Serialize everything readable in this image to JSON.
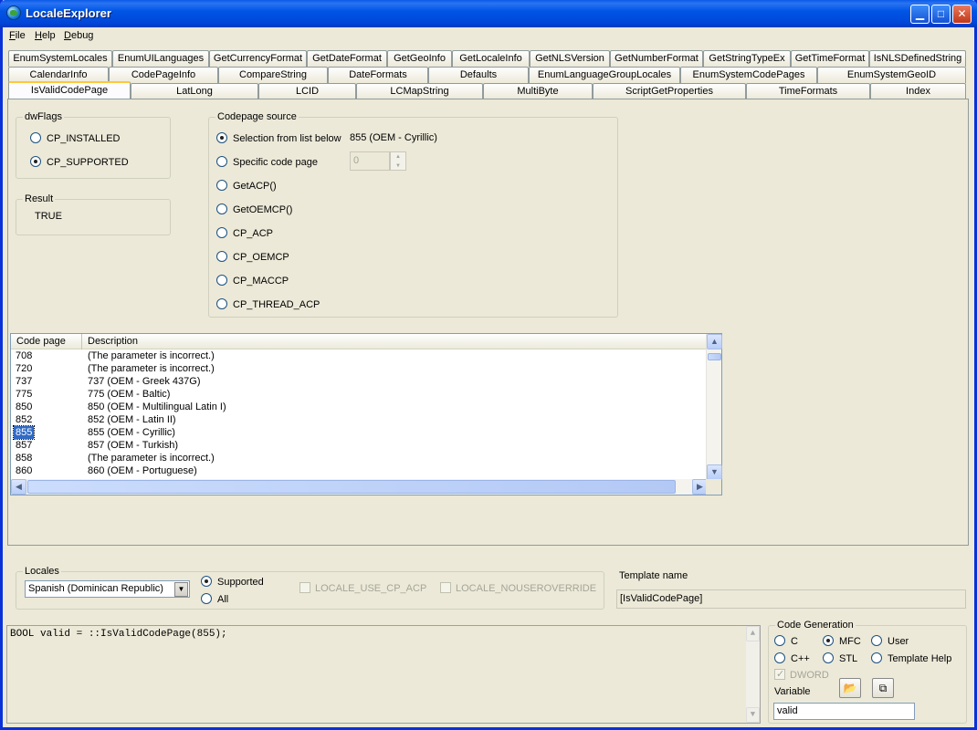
{
  "window": {
    "title": "LocaleExplorer"
  },
  "menu": [
    {
      "label": "File",
      "accel": "F",
      "rest": "ile"
    },
    {
      "label": "Help",
      "accel": "H",
      "rest": "elp"
    },
    {
      "label": "Debug",
      "accel": "D",
      "rest": "ebug"
    }
  ],
  "tabs": {
    "row1": [
      "EnumSystemLocales",
      "EnumUILanguages",
      "GetCurrencyFormat",
      "GetDateFormat",
      "GetGeoInfo",
      "GetLocaleInfo",
      "GetNLSVersion",
      "GetNumberFormat",
      "GetStringTypeEx",
      "GetTimeFormat",
      "IsNLSDefinedString"
    ],
    "row2": [
      "CalendarInfo",
      "CodePageInfo",
      "CompareString",
      "DateFormats",
      "Defaults",
      "EnumLanguageGroupLocales",
      "EnumSystemCodePages",
      "EnumSystemGeoID"
    ],
    "row3": [
      "IsValidCodePage",
      "LatLong",
      "LCID",
      "LCMapString",
      "MultiByte",
      "ScriptGetProperties",
      "TimeFormats",
      "Index"
    ],
    "active": "IsValidCodePage"
  },
  "dwflags": {
    "legend": "dwFlags",
    "options": [
      {
        "label": "CP_INSTALLED",
        "selected": false
      },
      {
        "label": "CP_SUPPORTED",
        "selected": true
      }
    ]
  },
  "result": {
    "legend": "Result",
    "value": "TRUE"
  },
  "codepage_source": {
    "legend": "Codepage source",
    "options": [
      {
        "label": "Selection from list below",
        "selected": true
      },
      {
        "label": "Specific code page",
        "selected": false
      },
      {
        "label": "GetACP()",
        "selected": false
      },
      {
        "label": "GetOEMCP()",
        "selected": false
      },
      {
        "label": "CP_ACP",
        "selected": false
      },
      {
        "label": "CP_OEMCP",
        "selected": false
      },
      {
        "label": "CP_MACCP",
        "selected": false
      },
      {
        "label": "CP_THREAD_ACP",
        "selected": false
      }
    ],
    "selection_display": "855   (OEM - Cyrillic)",
    "specific_value": "0"
  },
  "codepage_list": {
    "columns": [
      "Code page",
      "Description"
    ],
    "rows": [
      {
        "code": "708",
        "desc": "(The parameter is incorrect.)"
      },
      {
        "code": "720",
        "desc": "(The parameter is incorrect.)"
      },
      {
        "code": "737",
        "desc": "737   (OEM - Greek 437G)"
      },
      {
        "code": "775",
        "desc": "775   (OEM - Baltic)"
      },
      {
        "code": "850",
        "desc": "850   (OEM - Multilingual Latin I)"
      },
      {
        "code": "852",
        "desc": "852   (OEM - Latin II)"
      },
      {
        "code": "855",
        "desc": "855   (OEM - Cyrillic)"
      },
      {
        "code": "857",
        "desc": "857   (OEM - Turkish)"
      },
      {
        "code": "858",
        "desc": "(The parameter is incorrect.)"
      },
      {
        "code": "860",
        "desc": "860   (OEM - Portuguese)"
      }
    ],
    "selected_code": "855"
  },
  "locales": {
    "legend": "Locales",
    "selected": "Spanish (Dominican Republic)",
    "scope_options": [
      {
        "label": "Supported",
        "selected": true
      },
      {
        "label": "All",
        "selected": false
      }
    ],
    "flags": [
      {
        "label": "LOCALE_USE_CP_ACP",
        "checked": false
      },
      {
        "label": "LOCALE_NOUSEROVERRIDE",
        "checked": false
      }
    ]
  },
  "template": {
    "label": "Template name",
    "value": "[IsValidCodePage]"
  },
  "code_text": "BOOL valid = ::IsValidCodePage(855);",
  "code_generation": {
    "legend": "Code Generation",
    "options": [
      {
        "label": "C",
        "selected": false
      },
      {
        "label": "MFC",
        "selected": true
      },
      {
        "label": "User",
        "selected": false
      },
      {
        "label": "C++",
        "selected": false
      },
      {
        "label": "STL",
        "selected": false
      },
      {
        "label": "Template Help",
        "selected": false
      }
    ],
    "dword_label": "DWORD",
    "dword_checked": true,
    "variable_label": "Variable",
    "variable_value": "valid"
  }
}
